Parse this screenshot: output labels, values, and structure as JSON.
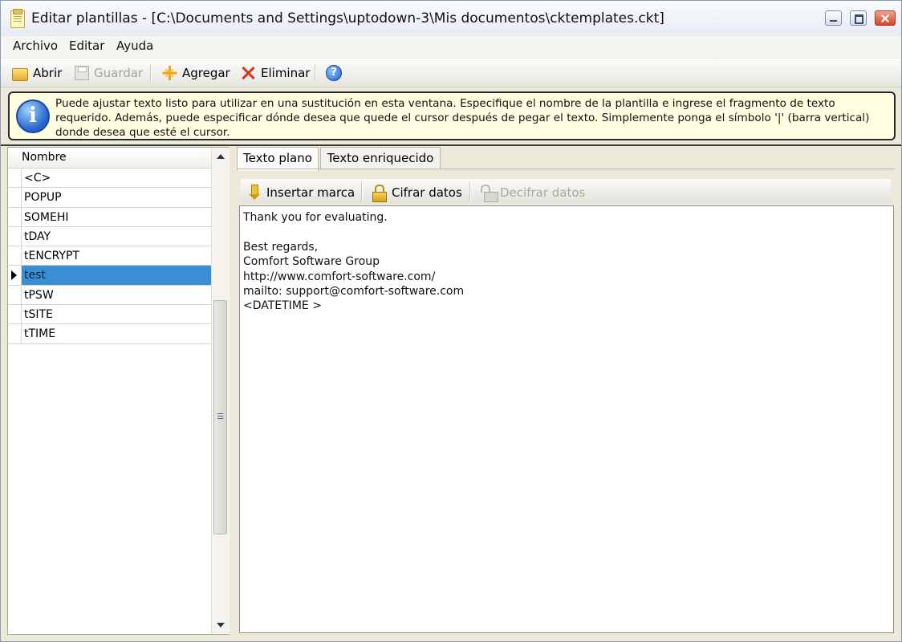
{
  "window": {
    "title": "Editar plantillas - [C:\\Documents and Settings\\uptodown-3\\Mis documentos\\cktemplates.ckt]"
  },
  "menu": [
    "Archivo",
    "Editar",
    "Ayuda"
  ],
  "toolbar": {
    "open_label": "Abrir",
    "save_label": "Guardar",
    "add_label": "Agregar",
    "delete_label": "Eliminar"
  },
  "info": {
    "text": "Puede ajustar texto listo para utilizar en una sustitución en esta ventana. Especifique el nombre de la plantilla e ingrese el fragmento de texto requerido. Además, puede especificar dónde desea que quede el cursor después de pegar el texto. Simplemente ponga el símbolo '|' (barra vertical) donde desea que esté el cursor."
  },
  "template_list": {
    "header": "Nombre",
    "items": [
      "<C>",
      "POPUP",
      "SOMEHI",
      "tDAY",
      "tENCRYPT",
      "test",
      "tPSW",
      "tSITE",
      "tTIME"
    ],
    "selected": "test"
  },
  "tabs": [
    "Texto plano",
    "Texto enriquecido"
  ],
  "editor_toolbar": {
    "insert_label": "Insertar marca",
    "encrypt_label": "Cifrar datos",
    "decrypt_label": "Decifrar datos"
  },
  "editor": {
    "lines": [
      "Thank you for evaluating.",
      "",
      "Best regards,",
      "Comfort Software Group",
      "http://www.comfort-software.com/",
      "mailto: support@comfort-software.com",
      "<DATETIME >"
    ]
  },
  "colors": {
    "selection": "#3a8ed4",
    "info_background": "#ffffe1",
    "close_button": "#d2472c"
  }
}
